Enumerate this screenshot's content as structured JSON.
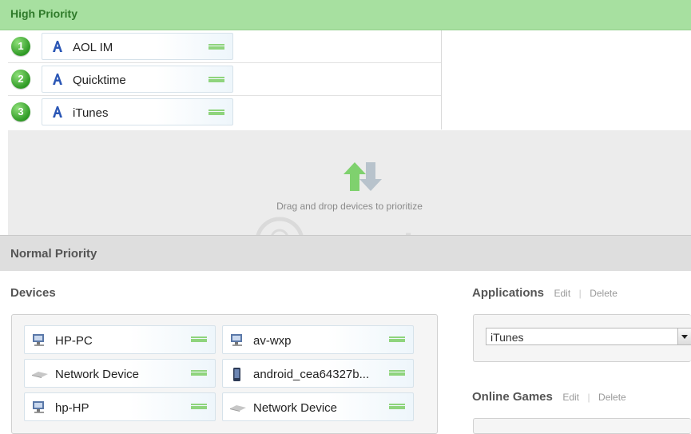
{
  "high_priority": {
    "title": "High Priority",
    "items": [
      {
        "rank": "1",
        "label": "AOL IM"
      },
      {
        "rank": "2",
        "label": "Quicktime"
      },
      {
        "rank": "3",
        "label": "iTunes"
      }
    ]
  },
  "dropzone": {
    "hint": "Drag and drop devices to prioritize"
  },
  "normal_priority": {
    "title": "Normal Priority"
  },
  "devices": {
    "title": "Devices",
    "items": [
      {
        "label": "HP-PC",
        "icon": "computer-icon"
      },
      {
        "label": "av-wxp",
        "icon": "computer-icon"
      },
      {
        "label": "Network Device",
        "icon": "network-device-icon"
      },
      {
        "label": "android_cea64327b...",
        "icon": "phone-icon"
      },
      {
        "label": "hp-HP",
        "icon": "computer-icon"
      },
      {
        "label": "Network Device",
        "icon": "network-device-icon"
      }
    ]
  },
  "applications": {
    "title": "Applications",
    "edit": "Edit",
    "sep": "|",
    "delete": "Delete",
    "selected": "iTunes"
  },
  "online_games": {
    "title": "Online Games",
    "edit": "Edit",
    "sep": "|",
    "delete": "Delete"
  },
  "watermark": {
    "text": "uantrimang"
  },
  "colors": {
    "high_header": "#a7e0a0",
    "grip": "#8fd47d",
    "rank_badge": "#2f9a25"
  }
}
